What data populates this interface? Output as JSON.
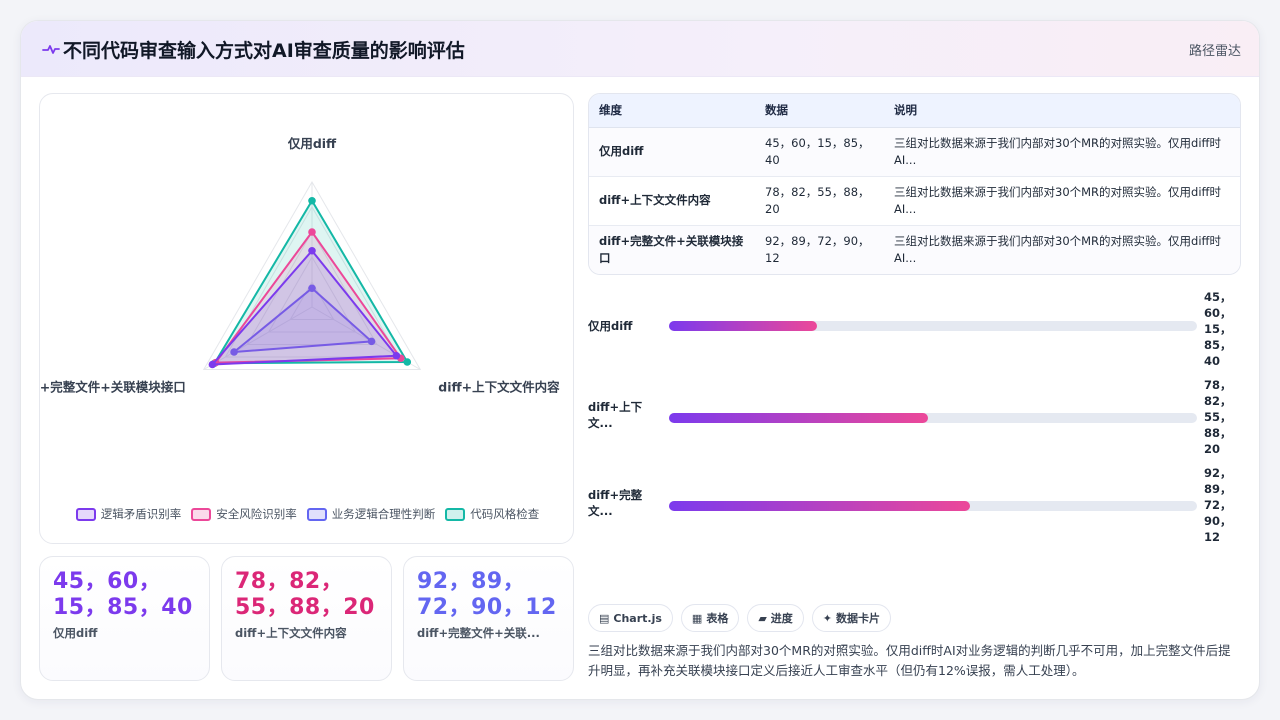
{
  "header": {
    "title": "不同代码审查输入方式对AI审查质量的影响评估",
    "right_label": "路径雷达",
    "accent": "#7c3aed"
  },
  "chart_data": {
    "type": "radar",
    "axes": [
      "仅用diff",
      "diff+上下文文件内容",
      "diff+完整文件+关联模块接口"
    ],
    "rlim": [
      0,
      100
    ],
    "series": [
      {
        "name": "逻辑矛盾识别率",
        "color": "#7c3aed",
        "values": [
          45,
          78,
          92
        ]
      },
      {
        "name": "安全风险识别率",
        "color": "#ec4899",
        "values": [
          60,
          82,
          89
        ]
      },
      {
        "name": "业务逻辑合理性判断",
        "color": "#6366f1",
        "values": [
          15,
          55,
          72
        ]
      },
      {
        "name": "代码风格检查",
        "color": "#14b8a6",
        "values": [
          85,
          88,
          90
        ]
      }
    ],
    "legend": "bottom"
  },
  "stats": [
    {
      "value": "45，60，15，85，40",
      "label": "仅用diff",
      "color": "#7c3aed"
    },
    {
      "value": "78，82，55，88，20",
      "label": "diff+上下文文件内容",
      "color": "#db2777"
    },
    {
      "value": "92，89，72，90，12",
      "label": "diff+完整文件+关联...",
      "color": "#6366f1"
    }
  ],
  "table": {
    "headers": [
      "维度",
      "数据",
      "说明"
    ],
    "rows": [
      {
        "dimension": "仅用diff",
        "data": "45，60，15，85，40",
        "note": "三组对比数据来源于我们内部对30个MR的对照实验。仅用diff时AI..."
      },
      {
        "dimension": "diff+上下文文件内容",
        "data": "78，82，55，88，20",
        "note": "三组对比数据来源于我们内部对30个MR的对照实验。仅用diff时AI..."
      },
      {
        "dimension": "diff+完整文件+关联模块接口",
        "data": "92，89，72，90，12",
        "note": "三组对比数据来源于我们内部对30个MR的对照实验。仅用diff时AI..."
      }
    ]
  },
  "bars": [
    {
      "label": "仅用diff",
      "value_text": "45，60，15，85，40",
      "fill": 0.28
    },
    {
      "label": "diff+上下文...",
      "value_text": "78，82，55，88，20",
      "fill": 0.49
    },
    {
      "label": "diff+完整文...",
      "value_text": "92，89，72，90，12",
      "fill": 0.57
    }
  ],
  "chips": [
    {
      "icon": "▤",
      "label": "Chart.js"
    },
    {
      "icon": "▦",
      "label": "表格"
    },
    {
      "icon": "▰",
      "label": "进度"
    },
    {
      "icon": "✦",
      "label": "数据卡片"
    }
  ],
  "note": "三组对比数据来源于我们内部对30个MR的对照实验。仅用diff时AI对业务逻辑的判断几乎不可用，加上完整文件后提升明显，再补充关联模块接口定义后接近人工审查水平（但仍有12%误报，需人工处理）。"
}
